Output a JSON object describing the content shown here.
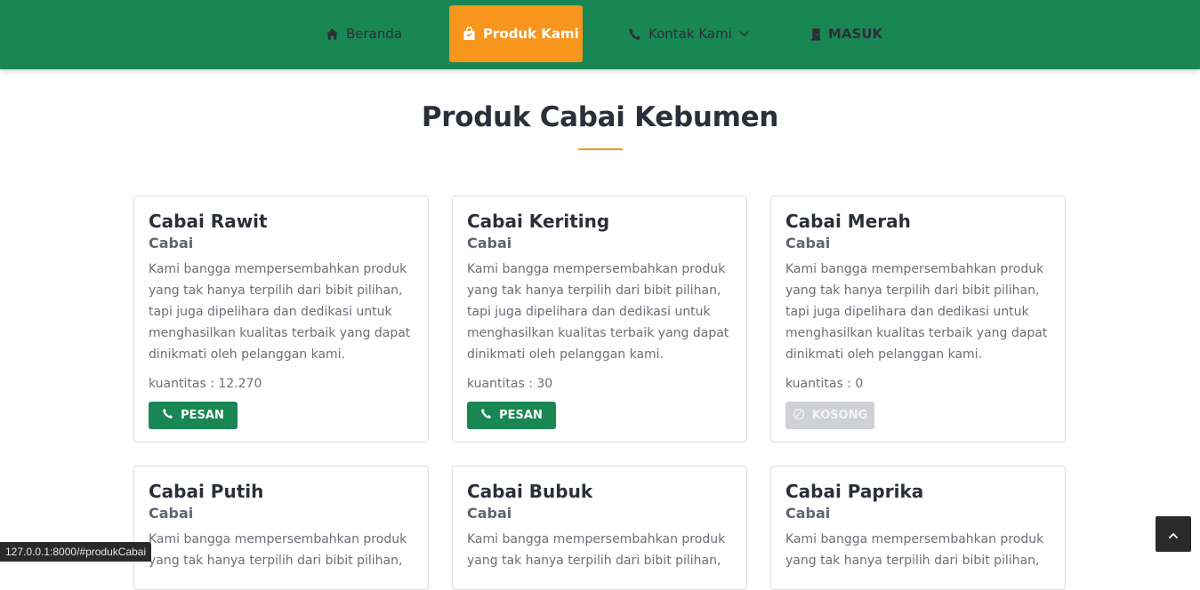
{
  "nav": {
    "items": [
      {
        "label": "Beranda",
        "icon": "home-icon"
      },
      {
        "label": "Produk Kami",
        "icon": "bag-icon"
      },
      {
        "label": "Kontak Kami",
        "icon": "phone-icon"
      },
      {
        "label": "MASUK",
        "icon": "door-icon"
      }
    ],
    "active_bg": "#f7951d",
    "bar_color": "#198754"
  },
  "section": {
    "title": "Produk Cabai Kebumen"
  },
  "products": [
    {
      "name": "Cabai Rawit",
      "category": "Cabai",
      "description": "Kami bangga mempersembahkan produk yang tak hanya terpilih dari bibit pilihan, tapi juga dipelihara dan dedikasi untuk menghasilkan kualitas terbaik yang dapat dinikmati oleh pelanggan kami.",
      "quantity": "kuantitas : 12.270",
      "button": "PESAN"
    },
    {
      "name": "Cabai Keriting",
      "category": "Cabai",
      "description": "Kami bangga mempersembahkan produk yang tak hanya terpilih dari bibit pilihan, tapi juga dipelihara dan dedikasi untuk menghasilkan kualitas terbaik yang dapat dinikmati oleh pelanggan kami.",
      "quantity": "kuantitas : 30",
      "button": "PESAN"
    },
    {
      "name": "Cabai Merah",
      "category": "Cabai",
      "description": "Kami bangga mempersembahkan produk yang tak hanya terpilih dari bibit pilihan, tapi juga dipelihara dan dedikasi untuk menghasilkan kualitas terbaik yang dapat dinikmati oleh pelanggan kami.",
      "quantity": "kuantitas : 0",
      "button": "KOSONG"
    },
    {
      "name": "Cabai Putih",
      "category": "Cabai",
      "description": "Kami bangga mempersembahkan produk yang tak hanya terpilih dari bibit pilihan,"
    },
    {
      "name": "Cabai Bubuk",
      "category": "Cabai",
      "description": "Kami bangga mempersembahkan produk yang tak hanya terpilih dari bibit pilihan,"
    },
    {
      "name": "Cabai Paprika",
      "category": "Cabai",
      "description": "Kami bangga mempersembahkan produk yang tak hanya terpilih dari bibit pilihan,"
    }
  ],
  "status_bar": {
    "url": "127.0.0.1:8000/#produkCabai"
  },
  "back_to_top": {
    "icon": "chevron-up-icon"
  }
}
